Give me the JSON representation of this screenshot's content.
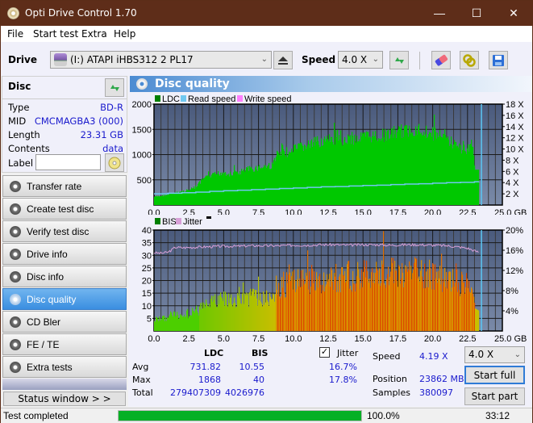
{
  "app": {
    "title": "Opti Drive Control 1.70"
  },
  "window_controls": {
    "minimize": "—",
    "maximize": "☐",
    "close": "✕"
  },
  "menu": [
    "File",
    "Start test",
    "Extra",
    "Help"
  ],
  "toolbar": {
    "drive_label": "Drive",
    "drive_value": "(I:)  ATAPI iHBS312   2 PL17",
    "speed_label": "Speed",
    "speed_value": "4.0 X",
    "icons": [
      "eject-icon",
      "refresh-icon",
      "eraser-icon",
      "copy-icon",
      "save-icon"
    ]
  },
  "disc": {
    "header": "Disc",
    "fields": [
      {
        "key": "Type",
        "value": "BD-R"
      },
      {
        "key": "MID",
        "value": "CMCMAGBA3 (000)"
      },
      {
        "key": "Length",
        "value": "23.31 GB"
      },
      {
        "key": "Contents",
        "value": "data"
      }
    ],
    "label_key": "Label",
    "label_value": ""
  },
  "nav": [
    {
      "label": "Transfer rate",
      "active": false
    },
    {
      "label": "Create test disc",
      "active": false
    },
    {
      "label": "Verify test disc",
      "active": false
    },
    {
      "label": "Drive info",
      "active": false
    },
    {
      "label": "Disc info",
      "active": false
    },
    {
      "label": "Disc quality",
      "active": true
    },
    {
      "label": "CD Bler",
      "active": false
    },
    {
      "label": "FE / TE",
      "active": false
    },
    {
      "label": "Extra tests",
      "active": false
    }
  ],
  "status_window_button": "Status window > >",
  "panel_title": "Disc quality",
  "colors": {
    "ldc": "#00c800",
    "read_speed": "#70c8f0",
    "write_speed": "#ff80ff",
    "bis": "#008000",
    "jitter": "#d8a0d8",
    "plot_bg_top": "#4a5a7c",
    "plot_bg_bottom": "#7a8aa8",
    "progress": "#06b025",
    "accent_blue": "#1a1acd"
  },
  "chart_data": [
    {
      "type": "area",
      "title": "LDC / Read speed",
      "legend": [
        "LDC",
        "Read speed",
        "Write speed"
      ],
      "legend_position": "top-left",
      "xlabel": "GB",
      "xlim": [
        0,
        25
      ],
      "x_ticks": [
        "0.0",
        "2.5",
        "5.0",
        "7.5",
        "10.0",
        "12.5",
        "15.0",
        "17.5",
        "20.0",
        "22.5",
        "25.0 GB"
      ],
      "ylim_left": [
        0,
        2000
      ],
      "y_ticks_left": [
        "500",
        "1000",
        "1500",
        "2000"
      ],
      "ylim_right": [
        0,
        18
      ],
      "y_ticks_right": [
        "2 X",
        "4 X",
        "6 X",
        "8 X",
        "10 X",
        "12 X",
        "14 X",
        "16 X",
        "18 X"
      ],
      "grid": true,
      "ldc_x": [
        0,
        0.5,
        1,
        1.5,
        2,
        2.5,
        3,
        3.5,
        4,
        4.5,
        5,
        5.5,
        6,
        6.5,
        7,
        7.5,
        8,
        8.5,
        8.7,
        9,
        9.5,
        10,
        10.5,
        11,
        11.5,
        12,
        12.5,
        13,
        13.5,
        14,
        14.5,
        15,
        15.5,
        16,
        16.5,
        17,
        17.5,
        18,
        18.5,
        19,
        19.5,
        20,
        20.5,
        21,
        21.5,
        22,
        22.5,
        22.8,
        23,
        23.31
      ],
      "ldc_values": [
        180,
        200,
        230,
        260,
        300,
        330,
        400,
        560,
        620,
        680,
        720,
        660,
        700,
        760,
        790,
        820,
        850,
        860,
        1080,
        1100,
        1150,
        1200,
        1260,
        1300,
        1350,
        1400,
        1400,
        1420,
        1420,
        1450,
        1450,
        1480,
        1500,
        1500,
        1520,
        1550,
        1600,
        1600,
        1650,
        1650,
        1600,
        1550,
        1500,
        1450,
        1320,
        1230,
        1220,
        1380,
        700,
        700
      ],
      "read_speed_x": [
        0,
        1,
        2,
        3,
        4,
        5,
        6,
        7,
        8,
        9,
        10,
        11,
        12,
        13,
        14,
        15,
        16,
        17,
        18,
        19,
        20,
        21,
        22,
        23,
        23.31
      ],
      "read_speed_values": [
        2.0,
        2.1,
        2.2,
        2.3,
        2.45,
        2.55,
        2.65,
        2.75,
        2.85,
        2.95,
        3.05,
        3.15,
        3.25,
        3.3,
        3.4,
        3.5,
        3.55,
        3.65,
        3.75,
        3.8,
        3.9,
        4.0,
        4.05,
        4.15,
        4.19
      ],
      "marker_x": 23.5
    },
    {
      "type": "bar",
      "title": "BIS / Jitter",
      "legend": [
        "BIS",
        "Jitter"
      ],
      "legend_position": "top-left",
      "xlabel": "GB",
      "xlim": [
        0,
        25
      ],
      "x_ticks": [
        "0.0",
        "2.5",
        "5.0",
        "7.5",
        "10.0",
        "12.5",
        "15.0",
        "17.5",
        "20.0",
        "22.5",
        "25.0 GB"
      ],
      "ylim_left": [
        0,
        40
      ],
      "y_ticks_left": [
        "5",
        "10",
        "15",
        "20",
        "25",
        "30",
        "35",
        "40"
      ],
      "ylim_right_percent": [
        0,
        20
      ],
      "y_ticks_right": [
        "4%",
        "8%",
        "12%",
        "16%",
        "20%"
      ],
      "grid": true,
      "bis_x": [
        0,
        0.5,
        1,
        1.5,
        2,
        2.5,
        3,
        3.5,
        4,
        4.5,
        5,
        5.5,
        6,
        6.5,
        7,
        7.5,
        8,
        8.5,
        8.7,
        9,
        9.5,
        10,
        10.5,
        11,
        11.5,
        12,
        12.5,
        13,
        13.5,
        14,
        14.5,
        15,
        15.5,
        16,
        16.5,
        17,
        17.5,
        18,
        18.5,
        19,
        19.5,
        20,
        20.5,
        21,
        21.5,
        22,
        22.5,
        22.8,
        23,
        23.31
      ],
      "bis_values": [
        6,
        6,
        7,
        8,
        8,
        9,
        10,
        12,
        14,
        15,
        16,
        16,
        16,
        17,
        17,
        17,
        17,
        18,
        22,
        23,
        24,
        25,
        25,
        26,
        27,
        26,
        27,
        27,
        28,
        28,
        28,
        28,
        29,
        29,
        29,
        30,
        30,
        30,
        31,
        30,
        29,
        28,
        28,
        27,
        26,
        25,
        24,
        26,
        9,
        8
      ],
      "jitter_x": [
        0,
        0.5,
        1,
        1.3,
        1.5,
        2,
        3,
        4,
        5,
        6,
        7,
        8,
        9,
        10,
        11,
        12,
        13,
        14,
        15,
        16,
        17,
        18,
        19,
        20,
        21,
        22,
        22.5,
        23,
        23.31
      ],
      "jitter_values": [
        15.5,
        15.4,
        15.6,
        16.1,
        16.6,
        16.5,
        16.6,
        16.7,
        16.8,
        16.8,
        16.9,
        16.9,
        16.9,
        17.0,
        17.0,
        17.1,
        17.1,
        17.0,
        17.1,
        17.1,
        17.0,
        17.1,
        17.1,
        17.0,
        16.9,
        16.6,
        16.4,
        15.9,
        15.6
      ],
      "marker_x": 23.5
    }
  ],
  "stats": {
    "col_ldc": "LDC",
    "col_bis": "BIS",
    "jitter_label": "Jitter",
    "jitter_checked": true,
    "rows": [
      {
        "label": "Avg",
        "ldc": "731.82",
        "bis": "10.55",
        "jitter": "16.7%"
      },
      {
        "label": "Max",
        "ldc": "1868",
        "bis": "40",
        "jitter": "17.8%"
      },
      {
        "label": "Total",
        "ldc": "279407309",
        "bis": "4026976",
        "jitter": ""
      }
    ],
    "speed_label": "Speed",
    "speed_value": "4.19 X",
    "position_label": "Position",
    "position_value": "23862 MB",
    "samples_label": "Samples",
    "samples_value": "380097",
    "speed_select": "4.0 X",
    "start_full": "Start full",
    "start_part": "Start part"
  },
  "statusbar": {
    "text": "Test completed",
    "progress_percent": 100.0,
    "progress_text": "100.0%",
    "elapsed": "33:12"
  }
}
